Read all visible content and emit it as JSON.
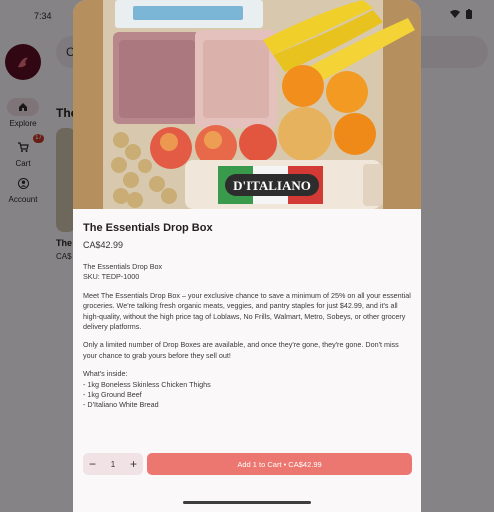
{
  "status": {
    "time": "7:34"
  },
  "background_app": {
    "search_prefix": "C",
    "rail": {
      "explore": "Explore",
      "cart": "Cart",
      "cart_badge": "17",
      "account": "Account"
    },
    "heading": "The",
    "card_title": "The",
    "card_price": "CA$"
  },
  "product": {
    "title": "The Essentials Drop Box",
    "price": "CA$42.99",
    "desc_name": "The Essentials Drop Box",
    "sku": "SKU: TEDP-1000",
    "paragraph_1": "Meet The Essentials Drop Box – your exclusive chance to save a minimum of 25% on all your essential groceries. We're talking fresh organic meats, veggies, and pantry staples for just $42.99, and it's all high-quality, without the high price tag of Loblaws, No Frills, Walmart, Metro, Sobeys, or other grocery delivery platforms.",
    "paragraph_2": "Only a limited number of Drop Boxes are available, and once they're gone, they're gone. Don't miss your chance to grab yours before they sell out!",
    "whats_inside": "What's inside:",
    "items": [
      "- 1kg Boneless Skinless Chicken Thighs",
      "- 1kg Ground Beef",
      "- D'Italiano White Bread"
    ],
    "bread_brand": "D'ITALIANO"
  },
  "purchase": {
    "minus": "−",
    "quantity": "1",
    "plus": "+",
    "add_label": "Add 1 to Cart • CA$42.99"
  },
  "colors": {
    "accent": "#ec7770",
    "brand": "#5a0d22",
    "qty_bg": "#f1e2e6"
  }
}
